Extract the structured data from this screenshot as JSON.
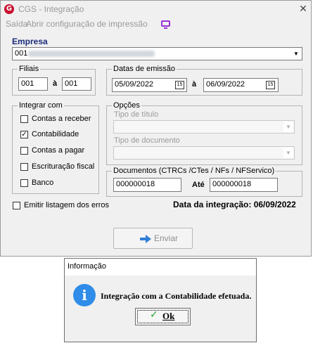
{
  "window": {
    "title": "CGS - Integração",
    "close_glyph": "✕"
  },
  "app_logo": {
    "letter": "G",
    "color": "#c8102e"
  },
  "menu": {
    "items": [
      "Saída",
      "Abrir configuração de impressão"
    ],
    "monitor_icon": "monitor-icon",
    "monitor_color": "#9b2fd6"
  },
  "empresa": {
    "label": "Empresa",
    "selected_value": "001"
  },
  "filiais": {
    "label": "Filiais",
    "from": "001",
    "separator": "à",
    "to": "001"
  },
  "datas_emissao": {
    "label": "Datas de emissão",
    "from": "05/09/2022",
    "separator": "à",
    "to": "06/09/2022",
    "calendar_icon_text": "15"
  },
  "integrar_com": {
    "label": "Integrar com",
    "options": [
      {
        "label": "Contas a receber",
        "checked": false
      },
      {
        "label": "Contabilidade",
        "checked": true
      },
      {
        "label": "Contas a pagar",
        "checked": false
      },
      {
        "label": "Escrituração fiscal",
        "checked": false
      },
      {
        "label": "Banco",
        "checked": false
      }
    ]
  },
  "opcoes": {
    "label": "Opções",
    "tipo_titulo_label": "Tipo de título",
    "tipo_documento_label": "Tipo de documento"
  },
  "documentos": {
    "label": "Documentos (CTRCs /CTes / NFs / NFServico)",
    "from": "000000018",
    "separator": "Até",
    "to": "000000018"
  },
  "emitir_listagem": {
    "label": "Emitir listagem dos erros",
    "checked": false
  },
  "data_integracao": "Data da integração: 06/09/2022",
  "enviar_button": {
    "label": "Enviar",
    "arrow_color": "#2f7fd6"
  },
  "dialog": {
    "title": "Informação",
    "message": "Integração com a Contabilidade efetuada.",
    "icon_glyph": "i",
    "ok_label": "Ok",
    "ok_check": "✓"
  }
}
